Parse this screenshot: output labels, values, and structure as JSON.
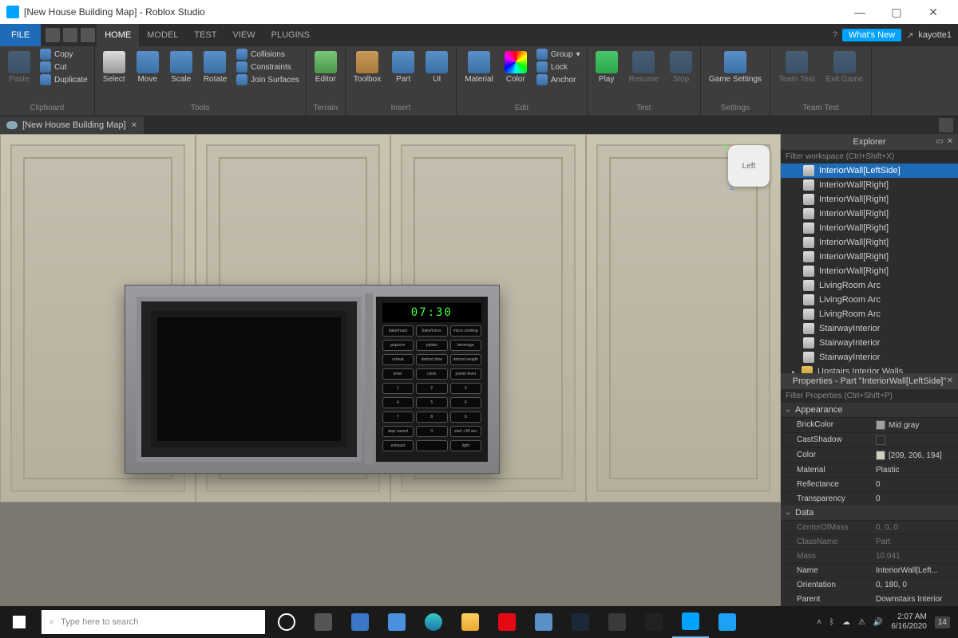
{
  "window": {
    "title": "[New House Building Map] - Roblox Studio"
  },
  "topstrip": {
    "file": "FILE",
    "tabs": [
      "HOME",
      "MODEL",
      "TEST",
      "VIEW",
      "PLUGINS"
    ],
    "active_tab": "HOME",
    "whatsnew": "What's New",
    "user": "kayotte1"
  },
  "ribbon": {
    "clipboard": {
      "label": "Clipboard",
      "paste": "Paste",
      "copy": "Copy",
      "cut": "Cut",
      "dup": "Duplicate"
    },
    "tools": {
      "label": "Tools",
      "select": "Select",
      "move": "Move",
      "scale": "Scale",
      "rotate": "Rotate",
      "collisions": "Collisions",
      "constraints": "Constraints",
      "join": "Join Surfaces"
    },
    "terrain": {
      "label": "Terrain",
      "editor": "Editor"
    },
    "insert": {
      "label": "Insert",
      "toolbox": "Toolbox",
      "part": "Part",
      "ui": "UI"
    },
    "edit": {
      "label": "Edit",
      "material": "Material",
      "color": "Color",
      "group": "Group",
      "lock": "Lock",
      "anchor": "Anchor"
    },
    "test": {
      "label": "Test",
      "play": "Play",
      "resume": "Resume",
      "stop": "Stop"
    },
    "settings": {
      "label": "Settings",
      "game": "Game Settings"
    },
    "teamtest": {
      "label": "Team Test",
      "team": "Team Test",
      "exit": "Exit Game"
    }
  },
  "doctab": {
    "name": "[New House Building Map]"
  },
  "viewport": {
    "microwave_time": "07:30",
    "cube_face": "Left",
    "axes": {
      "y": "Y",
      "z": "Z"
    },
    "mw_row1": [
      "bake/roast",
      "bake/micro",
      "micro cooking"
    ],
    "mw_row2": [
      "popcorn",
      "potato",
      "beverage"
    ],
    "mw_row3": [
      "reheat",
      "defrost time",
      "defrost weight"
    ],
    "mw_row4": [
      "timer",
      "clock",
      "power level"
    ],
    "mw_row5": [
      "1",
      "2",
      "3"
    ],
    "mw_row6": [
      "4",
      "5",
      "6"
    ],
    "mw_row7": [
      "7",
      "8",
      "9"
    ],
    "mw_row8": [
      "stop cancel",
      "0",
      "start +30 sec"
    ],
    "mw_row9": [
      "exhaust",
      "",
      "light"
    ]
  },
  "explorer": {
    "title": "Explorer",
    "filter_placeholder": "Filter workspace (Ctrl+Shift+X)",
    "items": [
      {
        "label": "InteriorWall[LeftSide]",
        "selected": true
      },
      {
        "label": "InteriorWall[Right]"
      },
      {
        "label": "InteriorWall[Right]"
      },
      {
        "label": "InteriorWall[Right]"
      },
      {
        "label": "InteriorWall[Right]"
      },
      {
        "label": "InteriorWall[Right]"
      },
      {
        "label": "InteriorWall[Right]"
      },
      {
        "label": "InteriorWall[Right]"
      },
      {
        "label": "LivingRoom Arc"
      },
      {
        "label": "LivingRoom Arc"
      },
      {
        "label": "LivingRoom Arc"
      },
      {
        "label": "StairwayInterior"
      },
      {
        "label": "StairwayInterior"
      },
      {
        "label": "StairwayInterior"
      }
    ],
    "folder": "Upstairs Interior Walls"
  },
  "properties": {
    "title": "Properties - Part \"InteriorWall[LeftSide]\"",
    "filter_placeholder": "Filter Properties (Ctrl+Shift+P)",
    "appearance": "Appearance",
    "brickcolor_k": "BrickColor",
    "brickcolor_v": "Mid gray",
    "brickcolor_hex": "#a0a0a0",
    "castshadow_k": "CastShadow",
    "color_k": "Color",
    "color_v": "[209, 206, 194]",
    "color_hex": "#d1cec2",
    "material_k": "Material",
    "material_v": "Plastic",
    "reflectance_k": "Reflectance",
    "reflectance_v": "0",
    "transparency_k": "Transparency",
    "transparency_v": "0",
    "data": "Data",
    "centerofmass_k": "CenterOfMass",
    "centerofmass_v": "0, 0, 0",
    "classname_k": "ClassName",
    "classname_v": "Part",
    "mass_k": "Mass",
    "mass_v": "10.041",
    "name_k": "Name",
    "name_v": "InteriorWall[Left...",
    "orientation_k": "Orientation",
    "orientation_v": "0, 180, 0",
    "parent_k": "Parent",
    "parent_v": "Downstairs Interior"
  },
  "taskbar": {
    "search_placeholder": "Type here to search",
    "time": "2:07 AM",
    "date": "6/16/2020",
    "notif": "14"
  }
}
